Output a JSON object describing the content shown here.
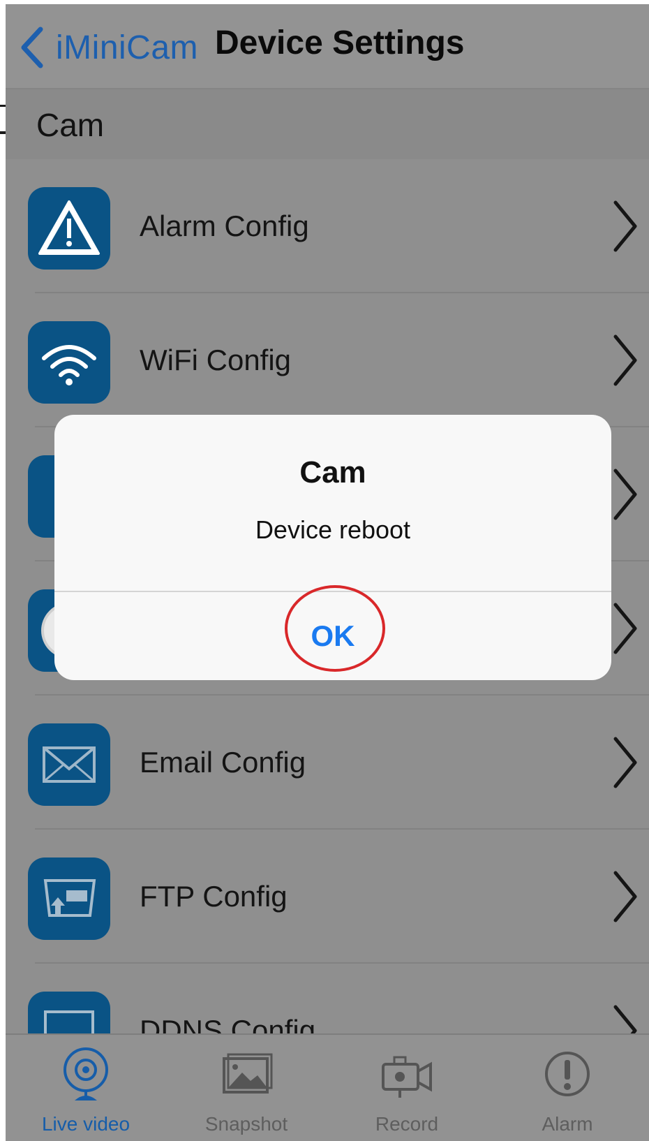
{
  "nav": {
    "back_label": "iMiniCam",
    "title": "Device Settings",
    "back_color": "#1d5fae"
  },
  "section": {
    "title": "Cam"
  },
  "rows": [
    {
      "label": "Alarm Config",
      "icon": "warning-icon"
    },
    {
      "label": "WiFi Config",
      "icon": "wifi-icon"
    },
    {
      "label": "",
      "icon": "info-icon"
    },
    {
      "label": "",
      "icon": "clock-icon"
    },
    {
      "label": "Email Config",
      "icon": "envelope-icon"
    },
    {
      "label": "FTP Config",
      "icon": "ftp-icon"
    },
    {
      "label": "DDNS Config",
      "icon": "ddns-icon"
    }
  ],
  "alert": {
    "title": "Cam",
    "message": "Device reboot",
    "ok_label": "OK",
    "ok_color": "#1a7af0"
  },
  "tabs": [
    {
      "label": "Live video",
      "icon": "webcam-icon",
      "active": true
    },
    {
      "label": "Snapshot",
      "icon": "picture-icon",
      "active": false
    },
    {
      "label": "Record",
      "icon": "video-camera-icon",
      "active": false
    },
    {
      "label": "Alarm",
      "icon": "exclamation-icon",
      "active": false
    }
  ],
  "colors": {
    "icon_tile": "#0a5385",
    "annotation": "#d9282a"
  }
}
